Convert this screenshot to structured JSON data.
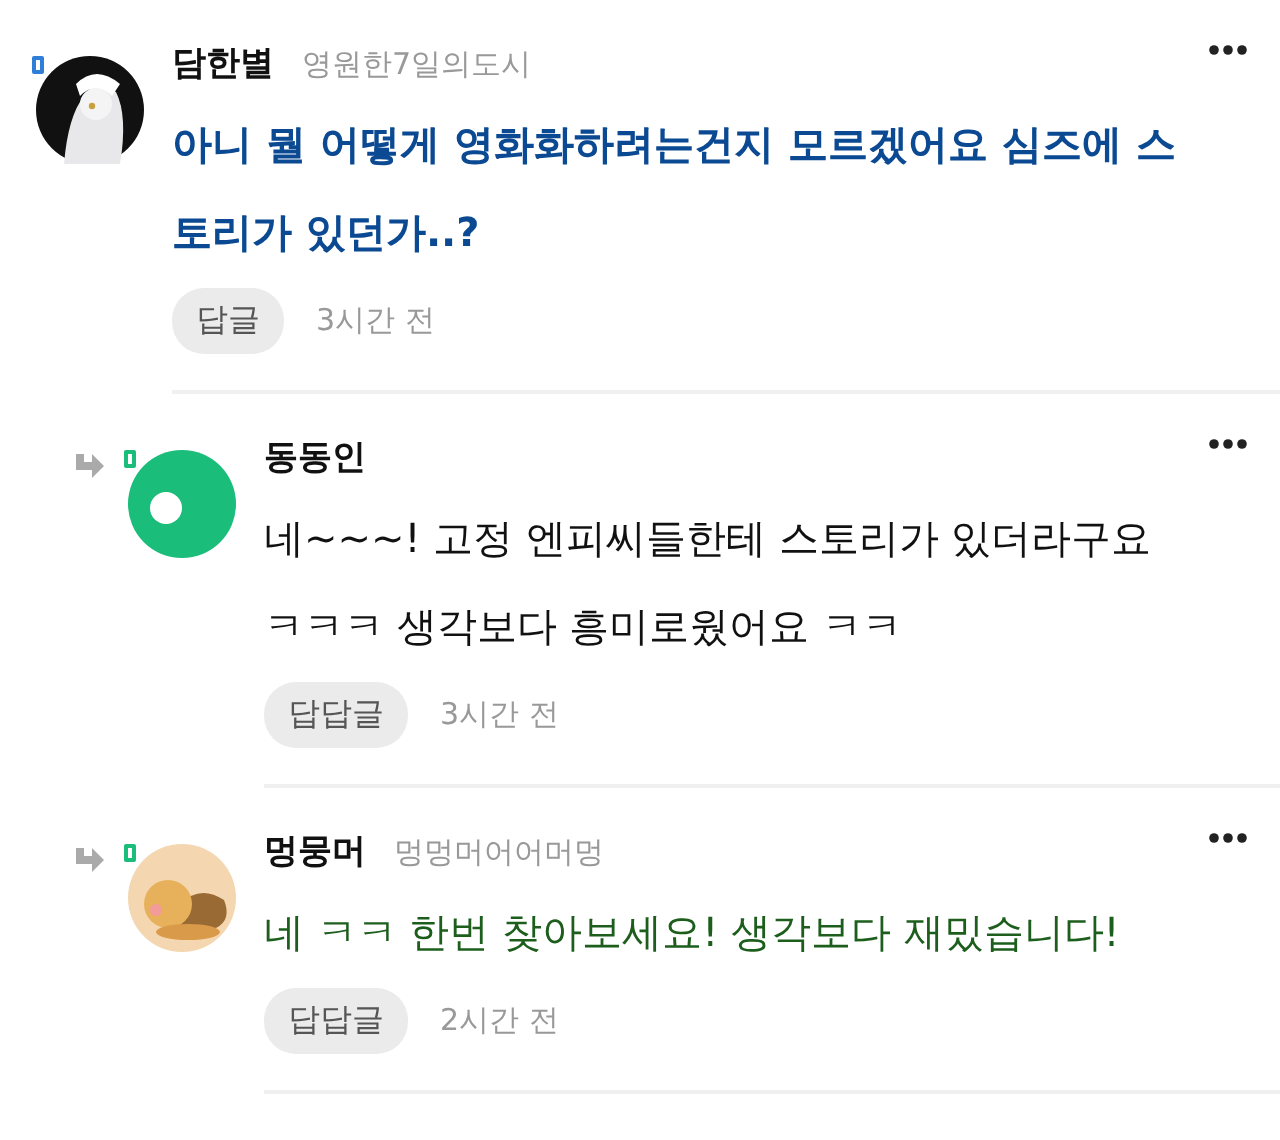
{
  "comments": [
    {
      "kind": "comment",
      "avatar": {
        "kind": "figure"
      },
      "author": "담한별",
      "nickname": "영원한7일의도시",
      "text": "아니 뭘 어떻게 영화화하려는건지 모르겠어요 심즈에 스토리가 있던가..?",
      "color": "#0b4a92",
      "bold": true,
      "reply_button": "답글",
      "time": "3시간 전"
    },
    {
      "kind": "reply",
      "avatar": {
        "kind": "default"
      },
      "author": "동동인",
      "text": "네~~~! 고정 엔피씨들한테 스토리가 있더라구요 ㅋㅋㅋ 생각보다 흥미로웠어요 ㅋㅋ",
      "color": "#111111",
      "bold": false,
      "reply_button": "답답글",
      "time": "3시간 전"
    },
    {
      "kind": "reply",
      "avatar": {
        "kind": "character"
      },
      "author": "멍뭉머",
      "nickname": "멍멍머어어머멍",
      "text": "네 ㅋㅋ 한번 찾아보세요! 생각보다 재밌습니다!",
      "color": "#1d5e1d",
      "bold": false,
      "reply_button": "답답글",
      "time": "2시간 전"
    }
  ]
}
